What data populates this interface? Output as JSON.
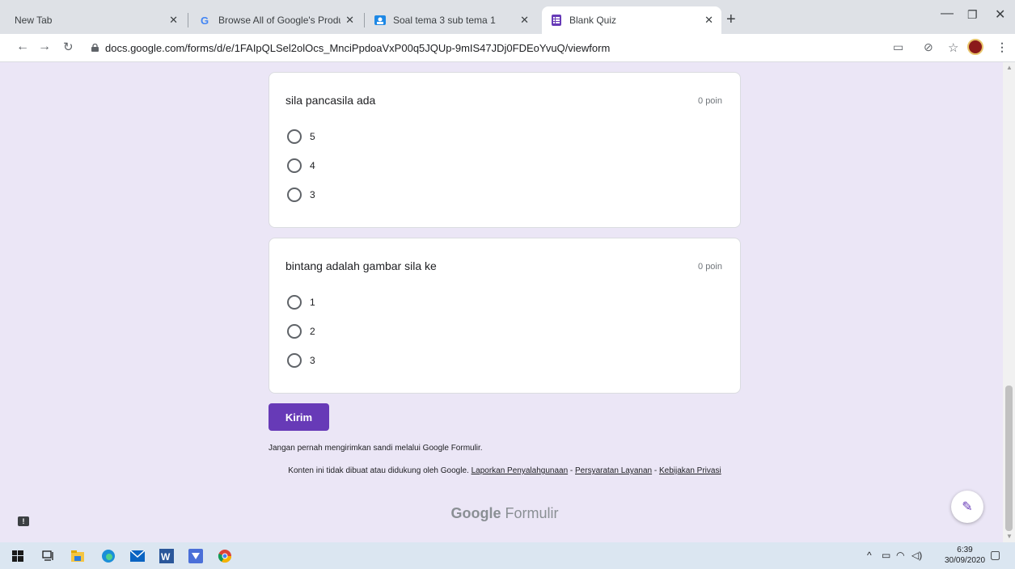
{
  "tabs": [
    {
      "label": "New Tab",
      "favicon": "none"
    },
    {
      "label": "Browse All of Google's Products",
      "favicon": "google-g-icon"
    },
    {
      "label": "Soal tema 3 sub tema 1",
      "favicon": "classroom-icon"
    },
    {
      "label": "Blank Quiz",
      "favicon": "google-forms-icon",
      "active": true
    }
  ],
  "address_bar": {
    "url": "docs.google.com/forms/d/e/1FAIpQLSel2olOcs_MnciPpdoaVxP00q5JQUp-9mIS47JDj0FDEoYvuQ/viewform"
  },
  "questions": [
    {
      "title": "sila pancasila ada",
      "points": "0 poin",
      "options": [
        "5",
        "4",
        "3"
      ]
    },
    {
      "title": "bintang adalah gambar sila ke",
      "points": "0 poin",
      "options": [
        "1",
        "2",
        "3"
      ]
    }
  ],
  "footer": {
    "submit_label": "Kirim",
    "warning": "Jangan pernah mengirimkan sandi melalui Google Formulir.",
    "disclaimer_prefix": "Konten ini tidak dibuat atau didukung oleh Google.",
    "link_report": "Laporkan Penyalahgunaan",
    "sep": " - ",
    "link_terms": "Persyaratan Layanan",
    "link_privacy": "Kebijakan Privasi",
    "logo_google": "Google",
    "logo_forms": "Formulir"
  },
  "taskbar": {
    "time": "6:39",
    "date": "30/09/2020"
  },
  "colors": {
    "accent": "#673ab7",
    "page_bg": "#ebe6f6",
    "taskbar_bg": "#dbe6f1"
  }
}
